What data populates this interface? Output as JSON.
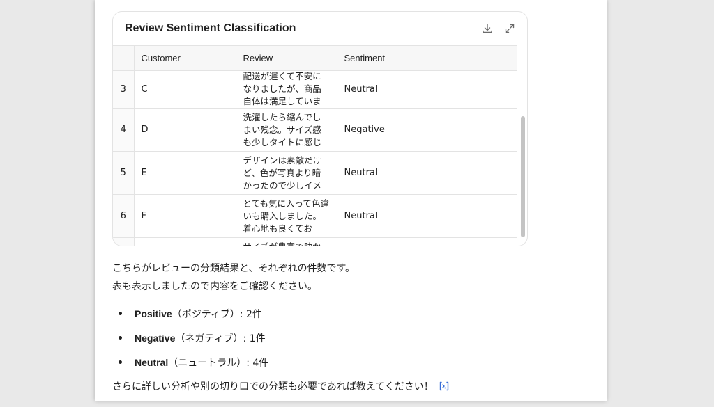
{
  "card": {
    "title": "Review Sentiment Classification",
    "icons": [
      "download-icon",
      "expand-icon"
    ]
  },
  "table": {
    "headers": [
      "",
      "Customer",
      "Review",
      "Sentiment",
      ""
    ],
    "rows": [
      {
        "index": "3",
        "customer": "C",
        "review": "配送が遅くて不安になりましたが、商品自体は満足していま",
        "sentiment": "Neutral"
      },
      {
        "index": "4",
        "customer": "D",
        "review": "洗濯したら縮んでしまい残念。サイズ感も少しタイトに感じ",
        "sentiment": "Negative"
      },
      {
        "index": "5",
        "customer": "E",
        "review": "デザインは素敵だけど、色が写真より暗かったので少しイメ",
        "sentiment": "Neutral"
      },
      {
        "index": "6",
        "customer": "F",
        "review": "とても気に入って色違いも購入しました。着心地も良くてお",
        "sentiment": "Neutral"
      },
      {
        "index": "",
        "customer": "",
        "review": "サイズが豊富で助か",
        "sentiment": ""
      }
    ]
  },
  "message": {
    "line1": "こちらがレビューの分類結果と、それぞれの件数です。",
    "line2": "表も表示しましたので内容をご確認ください。"
  },
  "summary": [
    {
      "label": "Positive",
      "detail": "（ポジティブ）: 2件"
    },
    {
      "label": "Negative",
      "detail": "（ネガティブ）: 1件"
    },
    {
      "label": "Neutral",
      "detail": "（ニュートラル）: 4件"
    }
  ],
  "closing": "さらに詳しい分析や別の切り口での分類も必要であれば教えてください！",
  "colors": {
    "background": "#e9e9e9",
    "panel": "#ffffff",
    "border": "#e3e3e3",
    "header_bg": "#f7f7f7",
    "cite_icon": "#3b6fd8"
  }
}
